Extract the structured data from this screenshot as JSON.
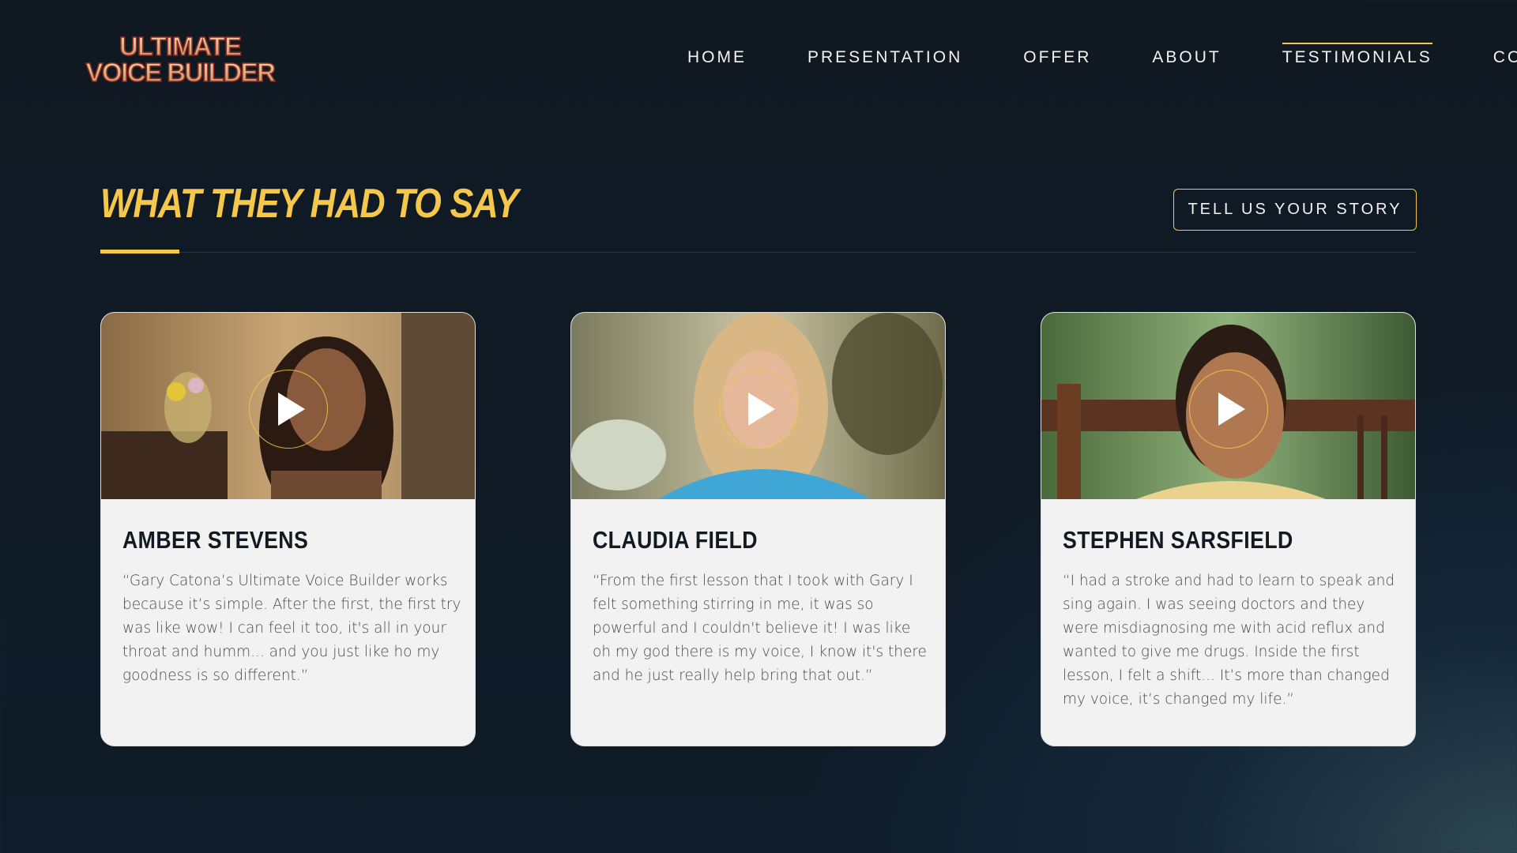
{
  "brand": {
    "logo_line1": "ULTIMATE",
    "logo_line2": "VOICE BUILDER"
  },
  "nav": {
    "items": [
      {
        "label": "HOME",
        "active": false
      },
      {
        "label": "PRESENTATION",
        "active": false
      },
      {
        "label": "OFFER",
        "active": false
      },
      {
        "label": "ABOUT",
        "active": false
      },
      {
        "label": "TESTIMONIALS",
        "active": true
      },
      {
        "label": "CONNECT",
        "active": false
      }
    ]
  },
  "section": {
    "title": "WHAT THEY HAD TO SAY",
    "cta_label": "TELL US YOUR STORY"
  },
  "testimonials": [
    {
      "name": "AMBER STEVENS",
      "quote": "“Gary Catona’s Ultimate Voice Builder works because it’s simple. After the first, the first try was like wow! I can feel it too, it's all in your throat and humm... and you just like ho my goodness is so different.”",
      "play_icon": "play-icon"
    },
    {
      "name": "CLAUDIA FIELD",
      "quote": "“From the first lesson that I took with Gary I felt something stirring in me, it was so powerful and I couldn't believe it! I was like oh my god there is my voice, I know it's there and he just really help bring that out.”",
      "play_icon": "play-icon"
    },
    {
      "name": "STEPHEN SARSFIELD",
      "quote": "“I had a stroke and had to learn to speak and sing again. I was seeing doctors and they were misdiagnosing me with acid reflux and wanted to give me drugs. Inside the first lesson, I felt a shift... It’s more than changed my voice, it’s changed my life.”",
      "play_icon": "play-icon"
    }
  ],
  "colors": {
    "accent": "#f5c84b",
    "background": "#111a24",
    "card": "#f2f2f2",
    "heading_text": "#111922"
  }
}
